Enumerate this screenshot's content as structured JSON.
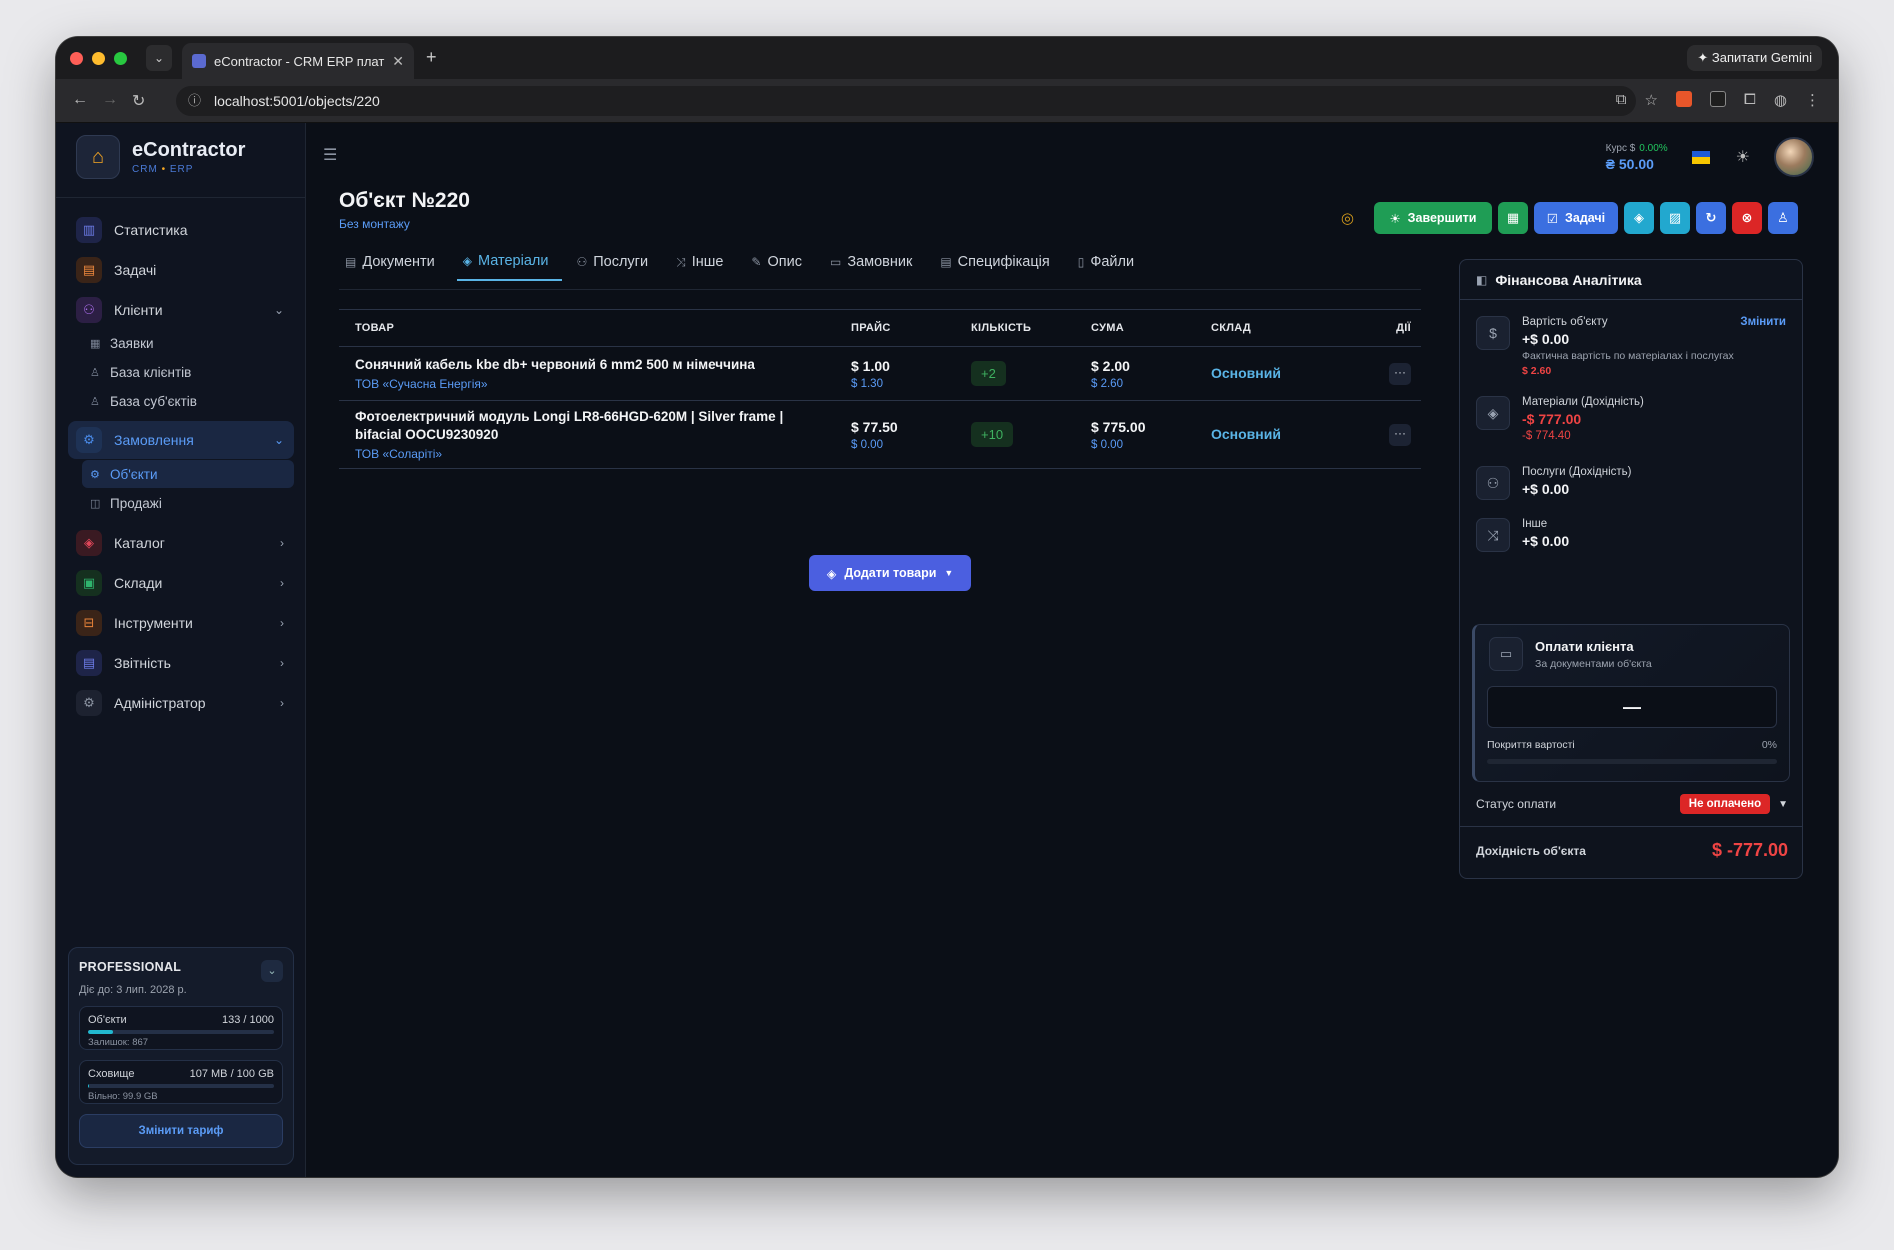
{
  "browser": {
    "tab_title": "eContractor - CRM ERP плат…",
    "url": "localhost:5001/objects/220",
    "gemini_label": "Запитати Gemini"
  },
  "brand": {
    "name": "eContractor",
    "sub_crm": "CRM",
    "sub_erp": "ERP"
  },
  "sidebar": {
    "items": [
      {
        "label": "Статистика",
        "icon": "bar-chart-icon",
        "color": "#6d7ce8"
      },
      {
        "label": "Задачі",
        "icon": "clipboard-icon",
        "color": "#f08a3e"
      },
      {
        "label": "Клієнти",
        "icon": "users-icon",
        "color": "#a86ce8"
      },
      {
        "label": "Замовлення",
        "icon": "settings-icon",
        "color": "#4a8ae8"
      },
      {
        "label": "Каталог",
        "icon": "box-icon",
        "color": "#e0475a"
      },
      {
        "label": "Склади",
        "icon": "warehouse-icon",
        "color": "#2fb36d"
      },
      {
        "label": "Інструменти",
        "icon": "toolbox-icon",
        "color": "#e8833a"
      },
      {
        "label": "Звітність",
        "icon": "report-icon",
        "color": "#6d7ce8"
      },
      {
        "label": "Адміністратор",
        "icon": "gear-icon",
        "color": "#8b93a1"
      }
    ],
    "clients_sub": [
      "Заявки",
      "База клієнтів",
      "База суб'єктів"
    ],
    "orders_sub": [
      "Об'єкти",
      "Продажі"
    ]
  },
  "plan": {
    "title": "PROFESSIONAL",
    "valid": "Діє до: 3 лип. 2028 р.",
    "objects_label": "Об'єкти",
    "objects_value": "133 / 1000",
    "objects_fraction": 0.133,
    "objects_note": "Залишок: 867",
    "storage_label": "Сховище",
    "storage_value": "107 MB / 100 GB",
    "storage_fraction": 0.001,
    "storage_note": "Вільно: 99.9 GB",
    "button": "Змінити тариф"
  },
  "header": {
    "rate_label": "Курс $",
    "rate_change": "0.00%",
    "rate_value": "₴ 50.00"
  },
  "page": {
    "title": "Об'єкт №220",
    "subtitle": "Без монтажу"
  },
  "actions": {
    "finish": "Завершити",
    "tasks": "Задачі"
  },
  "tabs": [
    {
      "label": "Документи",
      "icon": "document-icon"
    },
    {
      "label": "Матеріали",
      "icon": "box-icon"
    },
    {
      "label": "Послуги",
      "icon": "users-icon"
    },
    {
      "label": "Інше",
      "icon": "shuffle-icon"
    },
    {
      "label": "Опис",
      "icon": "edit-icon"
    },
    {
      "label": "Замовник",
      "icon": "id-card-icon"
    },
    {
      "label": "Специфікація",
      "icon": "clipboard-icon"
    },
    {
      "label": "Файли",
      "icon": "file-icon"
    }
  ],
  "table": {
    "headers": [
      "ТОВАР",
      "ПРАЙС",
      "КІЛЬКІСТЬ",
      "СУМА",
      "СКЛАД",
      "ДІЇ"
    ],
    "rows": [
      {
        "name": "Сонячний кабель kbe db+ червоний 6 mm2 500 м німеччина",
        "supplier": "ТОВ «Сучасна Енергія»",
        "price": "$ 1.00",
        "price_sub": "$ 1.30",
        "qty": "+2",
        "sum": "$ 2.00",
        "sum_sub": "$ 2.60",
        "warehouse": "Основний"
      },
      {
        "name": "Фотоелектричний модуль Longi LR8-66HGD-620M | Silver frame | bifacial OOCU9230920",
        "supplier": "ТОВ «Соларіті»",
        "price": "$ 77.50",
        "price_sub": "$ 0.00",
        "qty": "+10",
        "sum": "$ 775.00",
        "sum_sub": "$ 0.00",
        "warehouse": "Основний"
      }
    ],
    "add_button": "Додати товари"
  },
  "finance": {
    "title": "Фінансова Аналітика",
    "cost_label": "Вартість об'єкту",
    "cost_change": "Змінити",
    "cost_value": "+$ 0.00",
    "cost_note": "Фактична вартість по матеріалах і послугах",
    "cost_actual": "$ 2.60",
    "materials_label": "Матеріали (Дохідність)",
    "materials_value": "-$ 777.00",
    "materials_sub": "-$ 774.40",
    "services_label": "Послуги (Дохідність)",
    "services_value": "+$ 0.00",
    "other_label": "Інше",
    "other_value": "+$ 0.00",
    "payments_title": "Оплати клієнта",
    "payments_sub": "За документами об'єкта",
    "payments_value": "—",
    "coverage_label": "Покриття вартості",
    "coverage_pct": "0%",
    "status_label": "Статус оплати",
    "status_value": "Не оплачено",
    "profit_label": "Дохідність об'єкта",
    "profit_value": "$ -777.00"
  }
}
